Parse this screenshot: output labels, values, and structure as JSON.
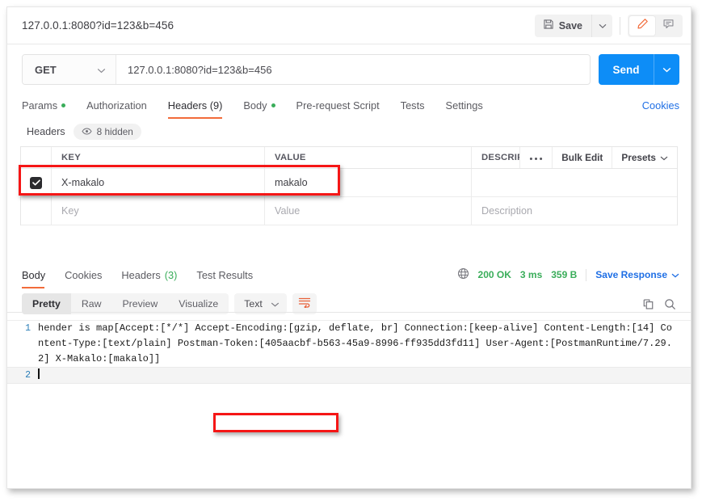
{
  "topbar": {
    "tab_title": "127.0.0.1:8080?id=123&b=456",
    "save_label": "Save",
    "save_icon": "floppy-disk-icon",
    "save_caret_icon": "chevron-down-icon",
    "edit_icon": "pencil-icon",
    "comment_icon": "comment-icon"
  },
  "request": {
    "method": "GET",
    "method_caret_icon": "chevron-down-icon",
    "url": "127.0.0.1:8080?id=123&b=456",
    "send_label": "Send",
    "send_caret_icon": "chevron-down-icon",
    "tabs": [
      {
        "label": "Params",
        "dot": true,
        "active": false
      },
      {
        "label": "Authorization",
        "dot": false,
        "active": false
      },
      {
        "label": "Headers (9)",
        "dot": false,
        "active": true
      },
      {
        "label": "Body",
        "dot": true,
        "active": false
      },
      {
        "label": "Pre-request Script",
        "dot": false,
        "active": false
      },
      {
        "label": "Tests",
        "dot": false,
        "active": false
      },
      {
        "label": "Settings",
        "dot": false,
        "active": false
      }
    ],
    "cookies_link": "Cookies"
  },
  "headers_panel": {
    "label": "Headers",
    "hidden_pill": "8 hidden",
    "eye_icon": "eye-icon",
    "columns": {
      "key": "KEY",
      "value": "VALUE",
      "description": "DESCRIPTIO"
    },
    "actions": {
      "more_icon": "ellipsis-icon",
      "bulk_edit": "Bulk Edit",
      "presets": "Presets",
      "presets_caret_icon": "chevron-down-icon"
    },
    "rows": [
      {
        "checked": true,
        "key": "X-makalo",
        "value": "makalo",
        "description": ""
      }
    ],
    "new_row": {
      "key_placeholder": "Key",
      "value_placeholder": "Value",
      "description_placeholder": "Description"
    }
  },
  "response": {
    "tabs": [
      {
        "label": "Body",
        "count": "",
        "active": true
      },
      {
        "label": "Cookies",
        "count": "",
        "active": false
      },
      {
        "label": "Headers",
        "count": "(3)",
        "active": false
      },
      {
        "label": "Test Results",
        "count": "",
        "active": false
      }
    ],
    "globe_icon": "globe-icon",
    "status": "200 OK",
    "time": "3 ms",
    "size": "359 B",
    "save_response": "Save Response",
    "save_response_caret_icon": "chevron-down-icon",
    "view_modes": [
      {
        "label": "Pretty",
        "active": true
      },
      {
        "label": "Raw",
        "active": false
      },
      {
        "label": "Preview",
        "active": false
      },
      {
        "label": "Visualize",
        "active": false
      }
    ],
    "format": "Text",
    "format_caret_icon": "chevron-down-icon",
    "wrap_icon": "word-wrap-icon",
    "copy_icon": "copy-icon",
    "search_icon": "search-icon",
    "body_lines": [
      {
        "number": "1",
        "segments": [
          {
            "text": "hender is map[Accept:[*/*] Accept-Encoding:[gzip, deflate, br] Connection:[keep-alive] Content-Length:[14] Content-Type:[text/plain] Postman-Token:[405aacbf-b563-45a9-8996-ff935dd3fd11] User-Agent:[PostmanRuntime/7.29.2] ",
            "highlight": false
          },
          {
            "text": "X-Makalo:[makalo]]",
            "highlight": true
          }
        ]
      },
      {
        "number": "2",
        "segments": [
          {
            "text": "",
            "highlight": false
          }
        ]
      }
    ]
  },
  "annotations": {
    "accent_red": "#f51616",
    "header_row_box": "highlight around X-makalo header row",
    "body_token_box": "highlight around X-Makalo:[makalo]] in response body"
  }
}
